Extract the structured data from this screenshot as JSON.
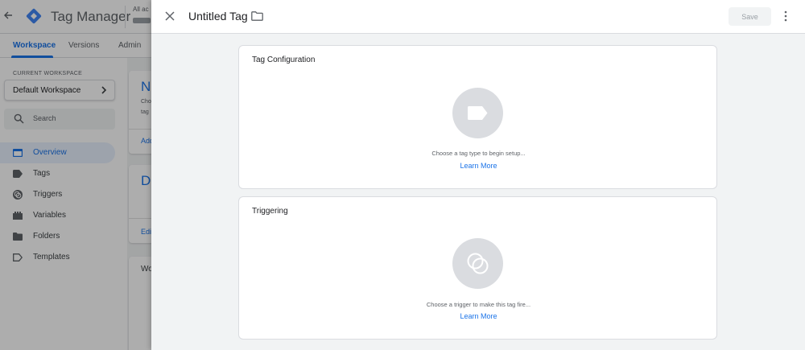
{
  "header": {
    "app_name": "Tag Manager",
    "accounts_label": "All ac"
  },
  "nav_tabs": [
    {
      "label": "Workspace",
      "active": true
    },
    {
      "label": "Versions",
      "active": false
    },
    {
      "label": "Admin",
      "active": false
    }
  ],
  "sidebar": {
    "current_workspace_label": "CURRENT WORKSPACE",
    "workspace_name": "Default Workspace",
    "search_placeholder": "Search",
    "items": [
      {
        "label": "Overview",
        "icon": "overview-icon",
        "active": true
      },
      {
        "label": "Tags",
        "icon": "tag-icon",
        "active": false
      },
      {
        "label": "Triggers",
        "icon": "trigger-icon",
        "active": false
      },
      {
        "label": "Variables",
        "icon": "variables-icon",
        "active": false
      },
      {
        "label": "Folders",
        "icon": "folder-icon",
        "active": false
      },
      {
        "label": "Templates",
        "icon": "template-icon",
        "active": false
      }
    ]
  },
  "background_cards": {
    "card1": {
      "title": "Ne",
      "line1": "Cho",
      "line2": "tag",
      "link": "Add"
    },
    "card2": {
      "title": "De",
      "link": "Edi"
    },
    "card3": {
      "title": "Wo"
    }
  },
  "sheet": {
    "title": "Untitled Tag",
    "save_label": "Save",
    "tag_configuration": {
      "title": "Tag Configuration",
      "hint": "Choose a tag type to begin setup...",
      "link": "Learn More"
    },
    "triggering": {
      "title": "Triggering",
      "hint": "Choose a trigger to make this tag fire...",
      "link": "Learn More"
    }
  },
  "colors": {
    "accent": "#1a73e8",
    "logo_blue": "#4285f4",
    "logo_dark": "#1967d2",
    "placeholder_circle": "#dadce0"
  }
}
